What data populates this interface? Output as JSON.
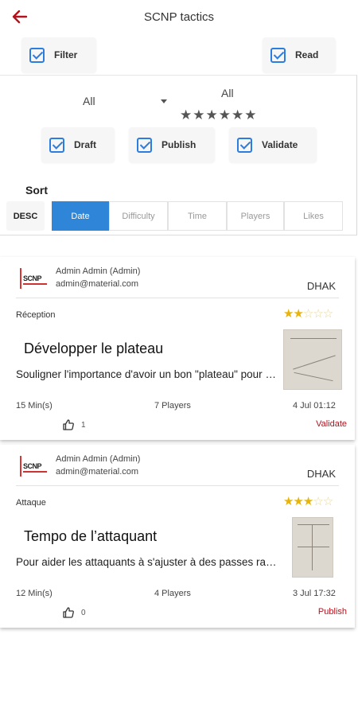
{
  "header": {
    "title": "SCNP tactics",
    "back_icon": "arrow-left-icon"
  },
  "toolbar": {
    "filter_label": "Filter",
    "read_label": "Read"
  },
  "filters": {
    "select_value": "All",
    "stars_label": "All",
    "stars_display": "★★★★★★",
    "status_checks": [
      {
        "label": "Draft",
        "checked": true
      },
      {
        "label": "Publish",
        "checked": true
      },
      {
        "label": "Validate",
        "checked": true
      }
    ]
  },
  "sort": {
    "label": "Sort",
    "order": "DESC",
    "options": [
      "Date",
      "Difficulty",
      "Time",
      "Players",
      "Likes"
    ],
    "active": "Date"
  },
  "colors": {
    "accent": "#b3121c",
    "checkbox": "#2b7de0",
    "active_tab": "#2f86d8",
    "star_on": "#e8b40a"
  },
  "cards": [
    {
      "logo_text": "SCNP",
      "author": "Admin Admin (Admin)",
      "email": "admin@material.com",
      "club": "DHAK",
      "category": "Réception",
      "rating": 2,
      "rating_max": 5,
      "stars_on": "★★",
      "stars_off": "☆☆☆",
      "title": "Développer le plateau",
      "description": "Souligner l'importance d'avoir un bon \"plateau\" pour bien attaquer",
      "duration": "15 Min(s)",
      "players": "7 Players",
      "date": "4 Jul 01:12",
      "likes": "1",
      "status": "Validate"
    },
    {
      "logo_text": "SCNP",
      "author": "Admin Admin (Admin)",
      "email": "admin@material.com",
      "club": "DHAK",
      "category": "Attaque",
      "rating": 3,
      "rating_max": 5,
      "stars_on": "★★★",
      "stars_off": "☆☆",
      "title": "Tempo de l’attaquant",
      "description": "Pour aider les attaquants à s'ajuster à des passes rapides",
      "duration": "12 Min(s)",
      "players": "4 Players",
      "date": "3 Jul 17:32",
      "likes": "0",
      "status": "Publish"
    }
  ]
}
